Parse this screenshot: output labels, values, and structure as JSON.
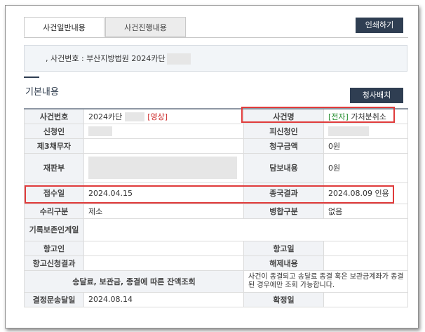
{
  "tabs": [
    {
      "label": "사건일반내용"
    },
    {
      "label": "사건진행내용"
    }
  ],
  "toolbar": {
    "print_label": "인쇄하기"
  },
  "case_header": {
    "text": ", 사건번호 : 부산지방법원 2024카단"
  },
  "section": {
    "title": "기본내용",
    "dispatch_label": "청사배치"
  },
  "rows": {
    "case_no": {
      "label": "사건번호",
      "value": "2024카단",
      "tag": "[영상]"
    },
    "case_name": {
      "label": "사건명",
      "tag": "[전자]",
      "value": "가처분취소"
    },
    "applicant": {
      "label": "신청인"
    },
    "respondent": {
      "label": "피신청인"
    },
    "third_debtor": {
      "label": "제3채무자"
    },
    "claim_amount": {
      "label": "청구금액",
      "value": "0원"
    },
    "division": {
      "label": "재판부"
    },
    "security": {
      "label": "담보내용",
      "value": "0원"
    },
    "received": {
      "label": "접수일",
      "value": "2024.04.15"
    },
    "final_result": {
      "label": "종국결과",
      "value": "2024.08.09 인용"
    },
    "accepted": {
      "label": "수리구분",
      "value": "제소"
    },
    "merged": {
      "label": "병합구분",
      "value": "없음"
    },
    "preservation": {
      "label": "기록보존인계일"
    },
    "appellant": {
      "label": "항고인"
    },
    "appeal_date": {
      "label": "항고일"
    },
    "appeal_result": {
      "label": "항고신청결과"
    },
    "release": {
      "label": "해제내용"
    },
    "balance": {
      "label": "송달료, 보관금, 종결에 따른 잔액조회",
      "note": "사건이 종결되고 송달료 종결 혹은 보관금계좌가 종결된 경우에만 조회 가능합니다."
    },
    "decision_served": {
      "label": "결정문송달일",
      "value": "2024.08.14"
    },
    "finalized": {
      "label": "확정일"
    }
  },
  "colors": {
    "accent": "#2f3e52",
    "highlight": "#e03b3b",
    "tag_red": "#cc2b2b",
    "tag_green": "#1f8a2a"
  }
}
